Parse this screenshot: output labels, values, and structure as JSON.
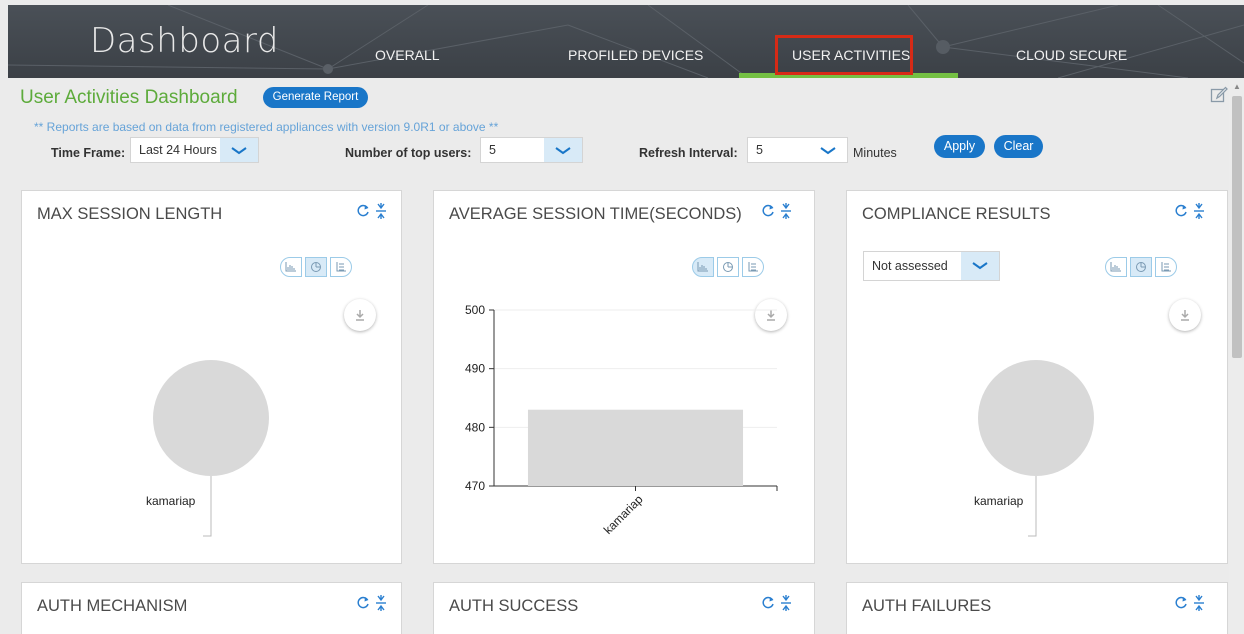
{
  "header": {
    "title": "Dashboard",
    "tabs": [
      {
        "label": "OVERALL"
      },
      {
        "label": "PROFILED DEVICES"
      },
      {
        "label": "USER ACTIVITIES",
        "active": true
      },
      {
        "label": "CLOUD SECURE"
      }
    ]
  },
  "page": {
    "title": "User Activities Dashboard",
    "generate_report_label": "Generate Report",
    "note": "** Reports are based on data from registered appliances with version 9.0R1 or above **"
  },
  "filters": {
    "time_frame_label": "Time Frame:",
    "time_frame_value": "Last 24 Hours",
    "top_users_label": "Number of top users:",
    "top_users_value": "5",
    "refresh_label": "Refresh Interval:",
    "refresh_value": "5",
    "minutes_label": "Minutes",
    "apply_label": "Apply",
    "clear_label": "Clear"
  },
  "panels": {
    "max_session": {
      "title": "MAX SESSION LENGTH",
      "pie_label": "kamariap"
    },
    "avg_session": {
      "title": "AVERAGE SESSION TIME(SECONDS)"
    },
    "compliance": {
      "title": "COMPLIANCE RESULTS",
      "filter_value": "Not assessed",
      "pie_label": "kamariap"
    },
    "auth_mechanism": {
      "title": "AUTH MECHANISM"
    },
    "auth_success": {
      "title": "AUTH SUCCESS"
    },
    "auth_failures": {
      "title": "AUTH FAILURES"
    }
  },
  "colors": {
    "accent": "#1976c8",
    "brand_green": "#5dab3b",
    "bar": "#d9d9d9",
    "highlight": "#d62a16"
  },
  "chart_data": [
    {
      "type": "pie",
      "categories": [
        "kamariap"
      ],
      "values": [
        1
      ]
    },
    {
      "type": "bar",
      "categories": [
        "kamariap"
      ],
      "values": [
        483
      ],
      "ylim": [
        470,
        500
      ],
      "yticks": [
        470,
        480,
        490,
        500
      ],
      "grid": true
    },
    {
      "type": "pie",
      "categories": [
        "kamariap"
      ],
      "values": [
        1
      ]
    }
  ]
}
